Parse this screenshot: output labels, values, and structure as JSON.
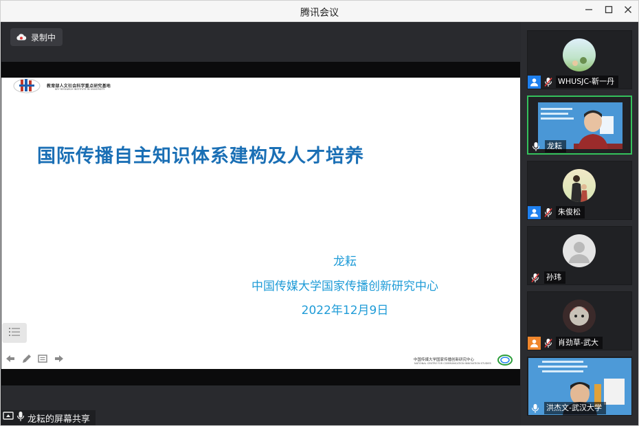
{
  "app": {
    "title": "腾讯会议",
    "window_controls": [
      "minimize-icon",
      "maximize-icon",
      "close-icon"
    ]
  },
  "recording": {
    "label": "录制中",
    "icon": "cloud-record-icon"
  },
  "slide": {
    "header_org": "教育部人文社会科学重点研究基地",
    "header_org_en": "KEY RESEARCH INSTITUTE IN UNIVERSITY",
    "title": "国际传播自主知识体系建构及人才培养",
    "presenter": "龙耘",
    "institution": "中国传媒大学国家传播创新研究中心",
    "date": "2022年12月9日",
    "footer_org": "中国传媒大学国家传播创新研究中心",
    "footer_org_en": "NATIONAL CENTRE FOR COMMUNICATION INNOVATION STUDIES"
  },
  "slide_controls": [
    "toc-icon",
    "arrow-left-icon",
    "pen-icon",
    "screen-icon",
    "arrow-right-icon"
  ],
  "screen_share_label": "龙耘的屏幕共享",
  "participants": [
    {
      "name": "WHUSJC-靳一丹",
      "has_user_icon": true,
      "muted": true
    },
    {
      "name": "龙耘",
      "has_user_icon": false,
      "muted": false,
      "active_speaker": true
    },
    {
      "name": "朱俊松",
      "has_user_icon": true,
      "muted": true
    },
    {
      "name": "孙玮",
      "has_user_icon": false,
      "muted": true
    },
    {
      "name": "肖劲草-武大",
      "has_user_icon": true,
      "muted": true
    },
    {
      "name": "洪杰文-武汉大学",
      "has_user_icon": false,
      "muted": false
    }
  ],
  "colors": {
    "title_blue": "#1a6fb5",
    "presenter_blue": "#1e9bd7",
    "active_border": "#34c25c",
    "user_icon_blue": "#1e80ef",
    "user_icon_orange": "#f0862c",
    "muted_red": "#e33b3b"
  }
}
